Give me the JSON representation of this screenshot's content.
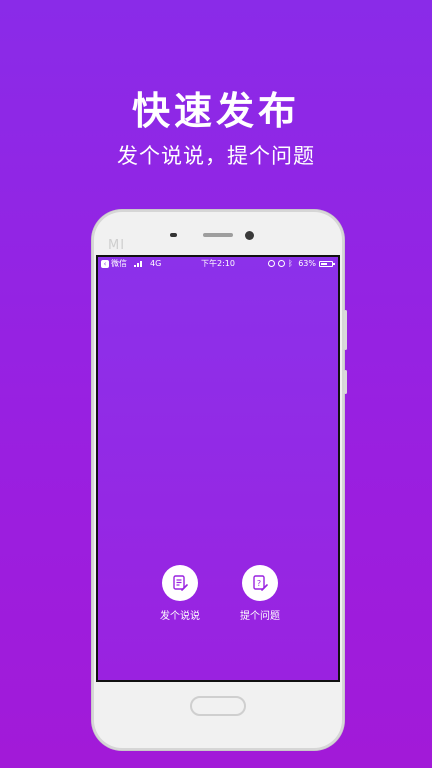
{
  "header": {
    "title": "快速发布",
    "subtitle": "发个说说，提个问题"
  },
  "device": {
    "logo_text": "MI"
  },
  "statusbar": {
    "back_app": "微信",
    "network": "4G",
    "time": "下午2:10",
    "battery_percent": "63%",
    "battery_level": 0.63
  },
  "actions": [
    {
      "label": "发个说说",
      "icon": "note-edit-icon"
    },
    {
      "label": "提个问题",
      "icon": "question-edit-icon"
    }
  ],
  "colors": {
    "background_top": "#8a2be8",
    "background_bottom": "#a21ad8",
    "icon_accent": "#9a22e0",
    "text": "#ffffff"
  }
}
